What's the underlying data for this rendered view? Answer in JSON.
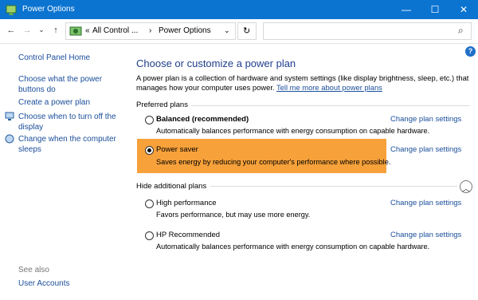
{
  "window": {
    "title": "Power Options",
    "minimize": "—",
    "maximize": "☐",
    "close": "✕"
  },
  "address": {
    "crumb_prefix": "«",
    "crumb_1": "All Control ...",
    "separator": "›",
    "crumb_2": "Power Options",
    "dropdown": "⌄"
  },
  "nav": {
    "back": "←",
    "forward": "→",
    "recent": "⌄",
    "up": "↑",
    "refresh": "↻",
    "search_icon": "⌕"
  },
  "sidebar": {
    "home": "Control Panel Home",
    "power_buttons_line1": "Choose what the power",
    "power_buttons_line2": "buttons do",
    "create_plan": "Create a power plan",
    "display_off_line1": "Choose when to turn off the",
    "display_off_line2": "display",
    "sleep_line1": "Change when the computer",
    "sleep_line2": "sleeps",
    "see_also": "See also",
    "user_accounts": "User Accounts"
  },
  "main": {
    "heading": "Choose or customize a power plan",
    "intro_line1": "A power plan is a collection of hardware and system settings (like display brightness, sleep, etc.) that",
    "intro_line2": "manages how your computer uses power.",
    "intro_link": "Tell me more about power plans",
    "preferred_label": "Preferred plans",
    "hide_label": "Hide additional plans",
    "change_label": "Change plan settings",
    "help": "?",
    "collapse": "︿",
    "plans": [
      {
        "name": "Balanced (recommended)",
        "desc": "Automatically balances performance with energy consumption on capable hardware.",
        "selected": false
      },
      {
        "name": "Power saver",
        "desc": "Saves energy by reducing your computer's performance where possible.",
        "selected": true
      },
      {
        "name": "High performance",
        "desc": "Favors performance, but may use more energy.",
        "selected": false
      },
      {
        "name": "HP Recommended",
        "desc": "Automatically balances performance with energy consumption on capable hardware.",
        "selected": false
      }
    ]
  },
  "colors": {
    "titlebar": "#0b74d1",
    "highlight": "#f7a13a",
    "link": "#1a4e9a",
    "heading": "#1f3e8c"
  }
}
